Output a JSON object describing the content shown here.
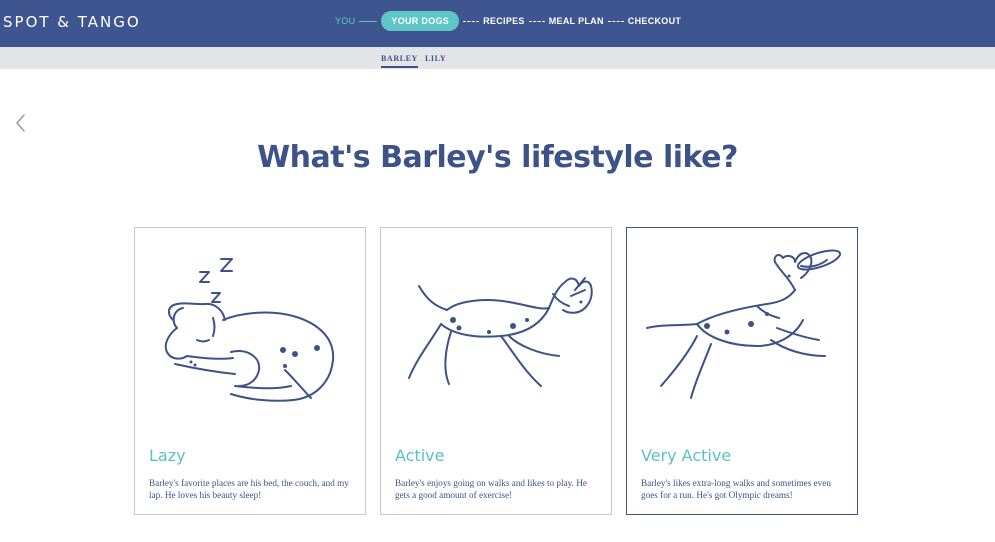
{
  "brand": "SPOT & TANGO",
  "progress_steps": [
    {
      "label": "YOU",
      "state": "done"
    },
    {
      "label": "YOUR DOGS",
      "state": "current"
    },
    {
      "label": "RECIPES",
      "state": "upcoming"
    },
    {
      "label": "MEAL PLAN",
      "state": "upcoming"
    },
    {
      "label": "CHECKOUT",
      "state": "upcoming"
    }
  ],
  "dog_tabs": [
    {
      "label": "BARLEY",
      "active": true
    },
    {
      "label": "LILY",
      "active": false
    }
  ],
  "back_icon": "chevron-left-icon",
  "headline": "What's Barley's lifestyle like?",
  "options": [
    {
      "title": "Lazy",
      "description": "Barley's favorite places are his bed, the couch, and my lap. He loves his beauty sleep!",
      "selected": false,
      "icon": "sleeping-dog-icon"
    },
    {
      "title": "Active",
      "description": "Barley's enjoys going on walks and likes to play. He gets a good amount of exercise!",
      "selected": false,
      "icon": "running-dog-icon"
    },
    {
      "title": "Very Active",
      "description": "Barley's likes extra-long walks and sometimes even goes for a run. He's got Olympic dreams!",
      "selected": true,
      "icon": "frisbee-dog-icon"
    }
  ],
  "colors": {
    "header": "#3f5590",
    "accent": "#5ec6c7",
    "ink": "#3d5287",
    "subbar": "#e2e4e8"
  }
}
